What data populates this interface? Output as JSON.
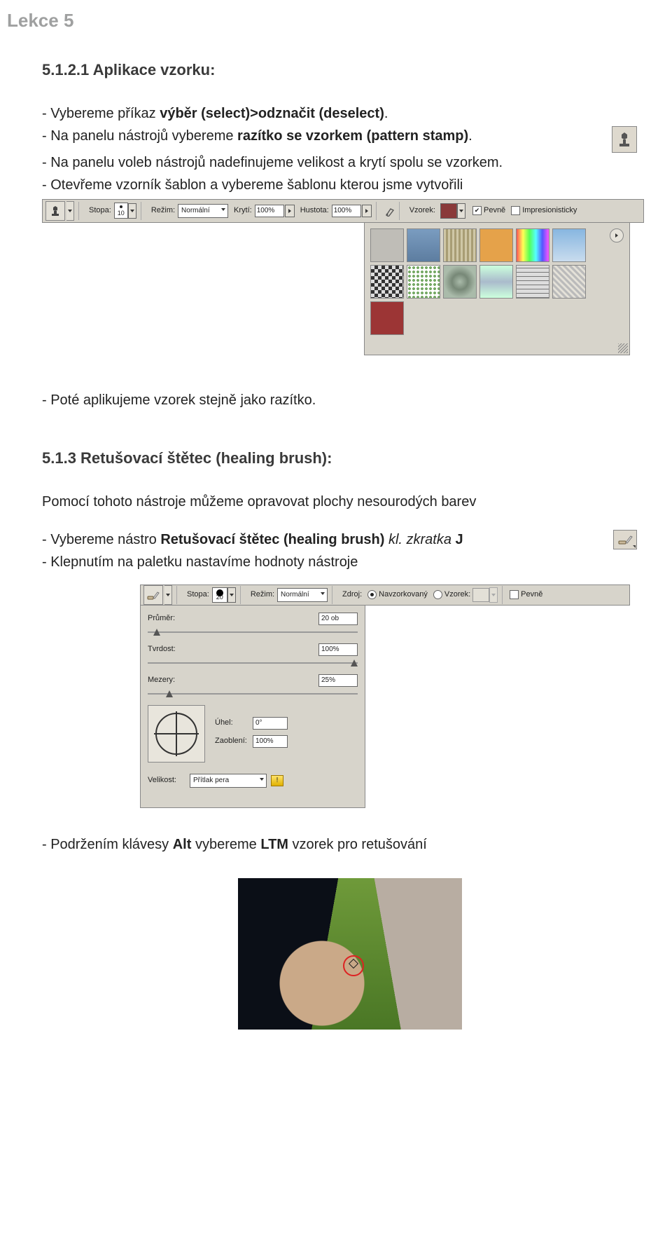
{
  "header": "Lekce 5",
  "section1": {
    "title": "5.1.2.1 Aplikace vzorku:",
    "lines": [
      [
        "- Vybereme příkaz ",
        "výběr (select)>odznačit (deselect)",
        "."
      ],
      [
        "- Na panelu nástrojů vybereme ",
        "razítko se vzorkem (pattern stamp)",
        "."
      ],
      [
        "- Na panelu voleb nástrojů nadefinujeme velikost a krytí spolu se vzorkem.",
        ""
      ],
      [
        "- Otevřeme vzorník šablon a vybereme šablonu kterou jsme vytvořili",
        ""
      ]
    ]
  },
  "optionBar1": {
    "stopa": "Stopa:",
    "stopa_val": "10",
    "rezim": "Režim:",
    "rezim_val": "Normální",
    "kryti": "Krytí:",
    "kryti_val": "100%",
    "hustota": "Hustota:",
    "hustota_val": "100%",
    "vzorek": "Vzorek:",
    "pevne": "Pevně",
    "impres": "Impresionisticky",
    "pevne_checked": true,
    "impres_checked": false
  },
  "afterPanel": "- Poté aplikujeme vzorek stejně jako razítko.",
  "section2": {
    "title": "5.1.3 Retušovací štětec (healing brush):",
    "intro": "Pomocí tohoto nástroje můžeme opravovat plochy nesourodých barev",
    "line2a": "- Vybereme nástro ",
    "line2b": "Retušovací štětec (healing brush)",
    "line2c": " kl. zkratka ",
    "line2d": "J",
    "line3": "- Klepnutím na paletku nastavíme hodnoty nástroje"
  },
  "optionBar2": {
    "stopa": "Stopa:",
    "stopa_val": "20",
    "rezim": "Režim:",
    "rezim_val": "Normální",
    "zdroj": "Zdroj:",
    "opt1": "Navzorkovaný",
    "opt2": "Vzorek:",
    "pevne": "Pevně",
    "pevne_checked": false
  },
  "popup": {
    "prumer": "Průměr:",
    "prumer_val": "20 ob",
    "tvrdost": "Tvrdost:",
    "tvrdost_val": "100%",
    "mezery": "Mezery:",
    "mezery_val": "25%",
    "uhel": "Úhel:",
    "uhel_val": "0°",
    "zaobleni": "Zaoblení:",
    "zaobleni_val": "100%",
    "velikost": "Velikost:",
    "velikost_val": "Přítlak pera"
  },
  "finalLine": {
    "a": "- Podržením klávesy ",
    "b": "Alt",
    "c": " vybereme ",
    "d": "LTM",
    "e": " vzorek pro retušování"
  }
}
